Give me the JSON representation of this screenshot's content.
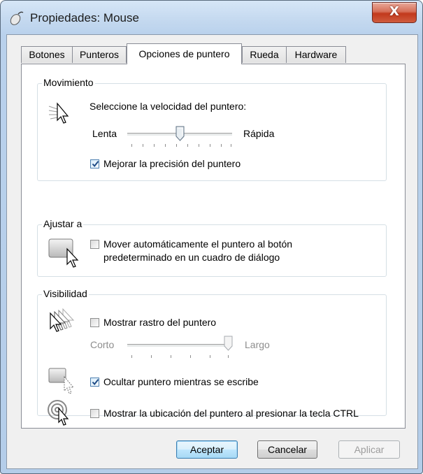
{
  "window": {
    "title": "Propiedades: Mouse",
    "close_label": "X"
  },
  "tabs": [
    {
      "label": "Botones"
    },
    {
      "label": "Punteros"
    },
    {
      "label": "Opciones de puntero"
    },
    {
      "label": "Rueda"
    },
    {
      "label": "Hardware"
    }
  ],
  "active_tab": "Opciones de puntero",
  "movimiento": {
    "title": "Movimiento",
    "speed_label": "Seleccione la velocidad del puntero:",
    "slow_label": "Lenta",
    "fast_label": "Rápida",
    "speed_value": 0.5,
    "precision_label": "Mejorar la precisión del puntero",
    "precision_checked": true
  },
  "ajustar": {
    "title": "Ajustar a",
    "snap_label_line1": "Mover automáticamente el puntero al botón",
    "snap_label_line2": "predeterminado en un cuadro de diálogo",
    "snap_checked": false
  },
  "visibilidad": {
    "title": "Visibilidad",
    "trails_label": "Mostrar rastro del puntero",
    "trails_checked": false,
    "short_label": "Corto",
    "long_label": "Largo",
    "trail_value": 1.0,
    "hide_label": "Ocultar puntero mientras se escribe",
    "hide_checked": true,
    "ctrl_label": "Mostrar la ubicación del puntero al presionar la tecla CTRL",
    "ctrl_checked": false
  },
  "buttons": {
    "ok": "Aceptar",
    "cancel": "Cancelar",
    "apply": "Aplicar"
  }
}
